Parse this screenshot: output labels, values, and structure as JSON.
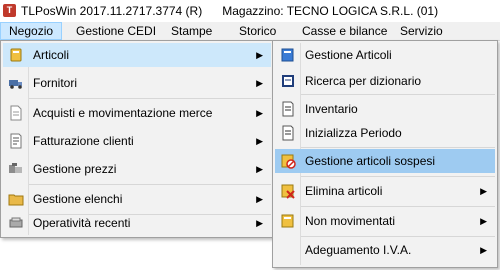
{
  "window": {
    "title": "TLPosWin 2017.11.2717.3774 (R)      Magazzino: TECNO LOGICA S.R.L. (01)"
  },
  "menubar": {
    "items": [
      {
        "label": "Negozio"
      },
      {
        "label": "Gestione CEDI"
      },
      {
        "label": "Stampe"
      },
      {
        "label": "Storico"
      },
      {
        "label": "Casse e bilance"
      },
      {
        "label": "Servizio"
      }
    ]
  },
  "negozio_menu": {
    "items": [
      {
        "label": "Articoli",
        "icon": "articles-icon"
      },
      {
        "label": "Fornitori",
        "icon": "truck-icon"
      },
      {
        "label": "Acquisti e movimentazione merce",
        "icon": "document-icon"
      },
      {
        "label": "Fatturazione clienti",
        "icon": "invoice-icon"
      },
      {
        "label": "Gestione prezzi",
        "icon": "prices-icon"
      },
      {
        "label": "Gestione elenchi",
        "icon": "folder-icon"
      },
      {
        "label": "Operatività recenti",
        "icon": "recent-icon"
      }
    ]
  },
  "articoli_menu": {
    "items": [
      {
        "label": "Gestione Articoli",
        "icon": "book-icon"
      },
      {
        "label": "Ricerca per dizionario",
        "icon": "dictionary-icon"
      },
      {
        "label": "Inventario",
        "icon": "inventory-icon"
      },
      {
        "label": "Inizializza Periodo",
        "icon": "period-icon"
      },
      {
        "label": "Gestione articoli sospesi",
        "icon": "suspended-icon"
      },
      {
        "label": "Elimina articoli",
        "icon": "delete-icon"
      },
      {
        "label": "Non movimentati",
        "icon": "non-moved-icon"
      },
      {
        "label": "Adeguamento I.V.A.",
        "icon": "vat-icon"
      }
    ]
  }
}
